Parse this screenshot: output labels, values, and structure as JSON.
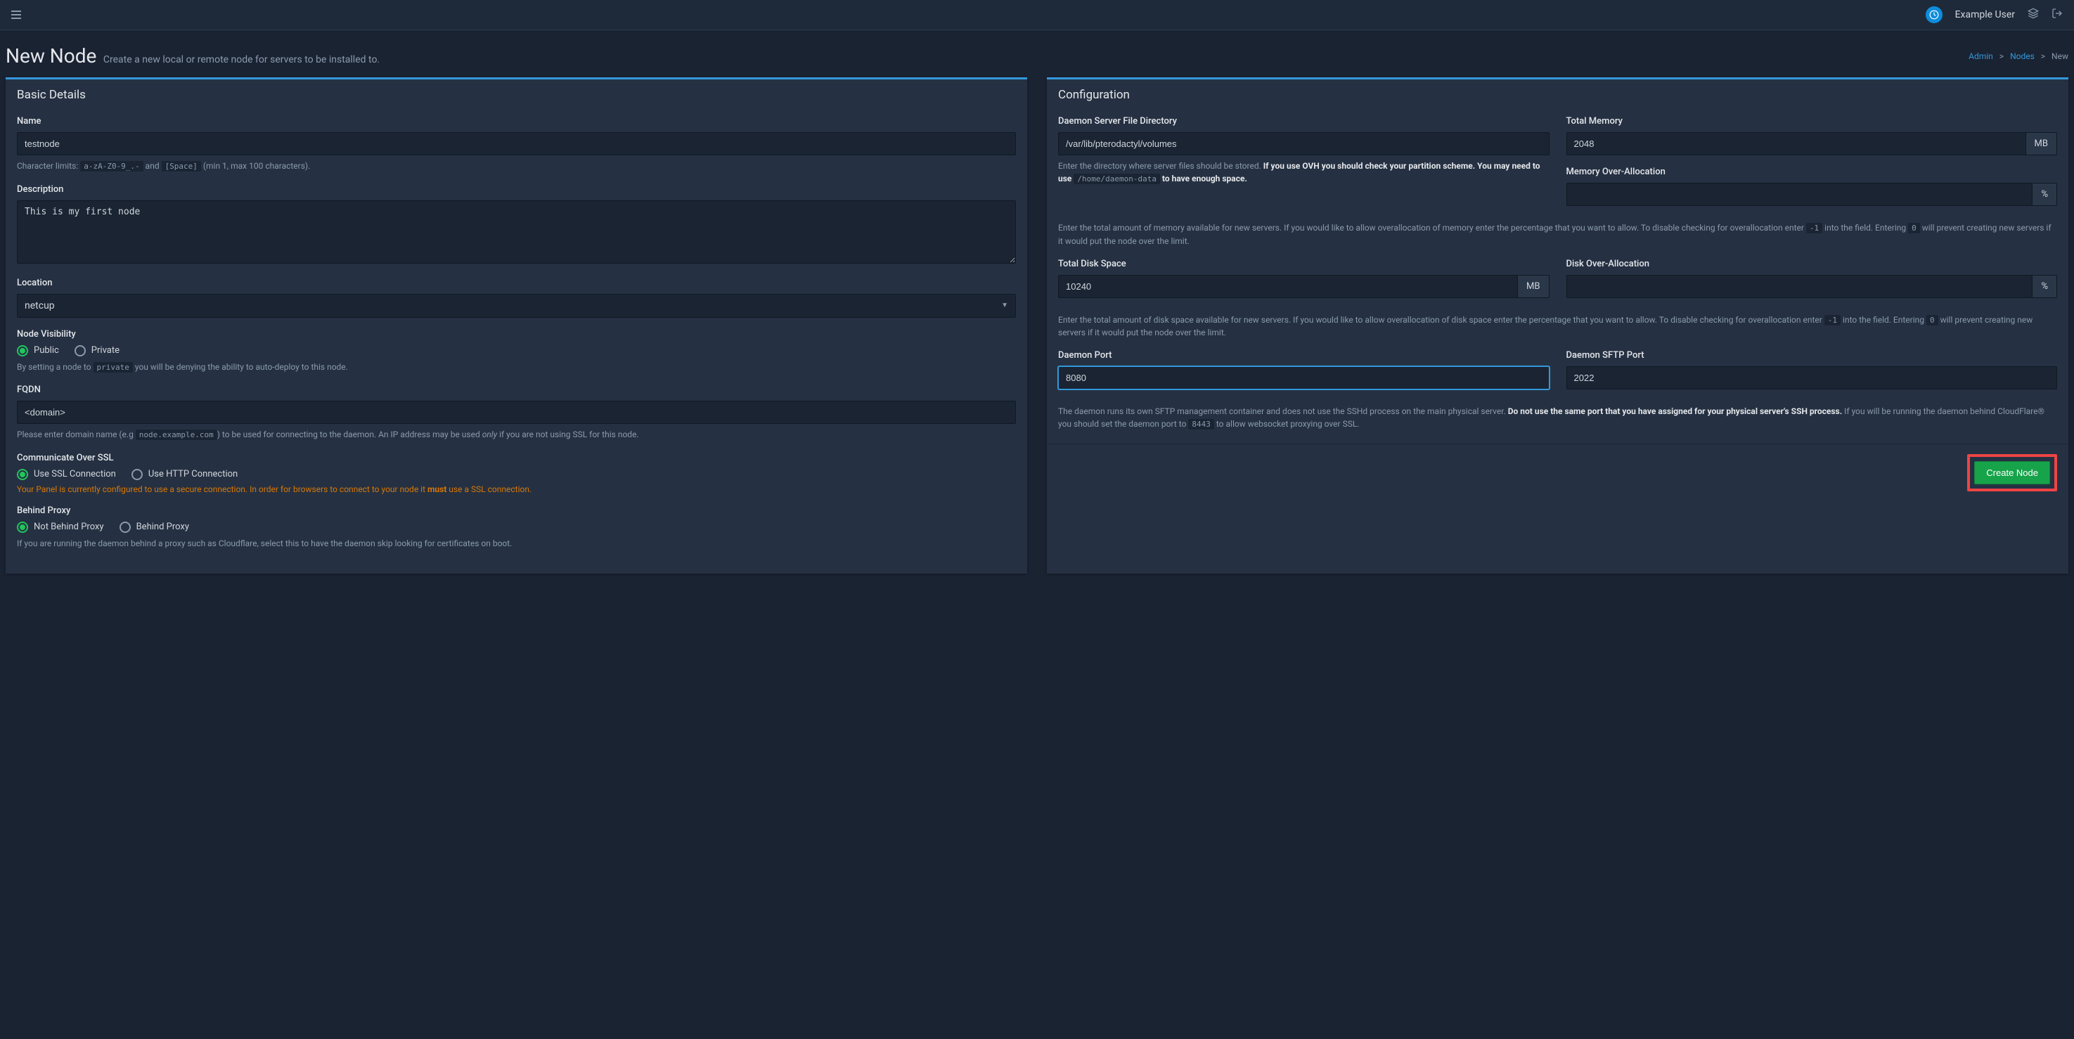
{
  "topbar": {
    "username": "Example User"
  },
  "header": {
    "title": "New Node",
    "subtitle": "Create a new local or remote node for servers to be installed to."
  },
  "breadcrumb": {
    "admin": "Admin",
    "nodes": "Nodes",
    "current": "New"
  },
  "basic": {
    "panel_title": "Basic Details",
    "name_label": "Name",
    "name_value": "testnode",
    "name_help_prefix": "Character limits: ",
    "name_help_code1": "a-zA-Z0-9_.-",
    "name_help_and": " and ",
    "name_help_code2": "[Space]",
    "name_help_suffix": " (min 1, max 100 characters).",
    "description_label": "Description",
    "description_value": "This is my first node",
    "location_label": "Location",
    "location_value": "netcup",
    "visibility_label": "Node Visibility",
    "visibility_public": "Public",
    "visibility_private": "Private",
    "visibility_help_prefix": "By setting a node to ",
    "visibility_help_code": "private",
    "visibility_help_suffix": " you will be denying the ability to auto-deploy to this node.",
    "fqdn_label": "FQDN",
    "fqdn_value": "<domain>",
    "fqdn_help_prefix": "Please enter domain name (e.g ",
    "fqdn_help_code": "node.example.com",
    "fqdn_help_mid": ") to be used for connecting to the daemon. An IP address may be used ",
    "fqdn_help_em": "only",
    "fqdn_help_suffix": " if you are not using SSL for this node.",
    "ssl_label": "Communicate Over SSL",
    "ssl_use": "Use SSL Connection",
    "ssl_http": "Use HTTP Connection",
    "ssl_warning_prefix": "Your Panel is currently configured to use a secure connection. In order for browsers to connect to your node it ",
    "ssl_warning_bold": "must",
    "ssl_warning_suffix": " use a SSL connection.",
    "proxy_label": "Behind Proxy",
    "proxy_not": "Not Behind Proxy",
    "proxy_yes": "Behind Proxy",
    "proxy_help": "If you are running the daemon behind a proxy such as Cloudflare, select this to have the daemon skip looking for certificates on boot."
  },
  "config": {
    "panel_title": "Configuration",
    "dir_label": "Daemon Server File Directory",
    "dir_value": "/var/lib/pterodactyl/volumes",
    "dir_help_prefix": "Enter the directory where server files should be stored. ",
    "dir_help_bold": "If you use OVH you should check your partition scheme. You may need to use ",
    "dir_help_code": "/home/daemon-data",
    "dir_help_bold2": " to have enough space.",
    "memory_label": "Total Memory",
    "memory_value": "2048",
    "memory_unit": "MB",
    "memory_over_label": "Memory Over-Allocation",
    "memory_over_value": "",
    "percent": "%",
    "memory_help_prefix": "Enter the total amount of memory available for new servers. If you would like to allow overallocation of memory enter the percentage that you want to allow. To disable checking for overallocation enter ",
    "memory_help_code1": "-1",
    "memory_help_mid": " into the field. Entering ",
    "memory_help_code2": "0",
    "memory_help_suffix": " will prevent creating new servers if it would put the node over the limit.",
    "disk_label": "Total Disk Space",
    "disk_value": "10240",
    "disk_unit": "MB",
    "disk_over_label": "Disk Over-Allocation",
    "disk_over_value": "",
    "disk_help_prefix": "Enter the total amount of disk space available for new servers. If you would like to allow overallocation of disk space enter the percentage that you want to allow. To disable checking for overallocation enter ",
    "disk_help_code1": "-1",
    "disk_help_mid": " into the field. Entering ",
    "disk_help_code2": "0",
    "disk_help_suffix": " will prevent creating new servers if it would put the node over the limit.",
    "daemon_port_label": "Daemon Port",
    "daemon_port_value": "8080",
    "sftp_port_label": "Daemon SFTP Port",
    "sftp_port_value": "2022",
    "sftp_help_prefix": "The daemon runs its own SFTP management container and does not use the SSHd process on the main physical server. ",
    "sftp_help_bold": "Do not use the same port that you have assigned for your physical server's SSH process.",
    "sftp_help_mid": " If you will be running the daemon behind CloudFlare® you should set the daemon port to ",
    "sftp_help_code": "8443",
    "sftp_help_suffix": " to allow websocket proxying over SSL.",
    "create_button": "Create Node"
  }
}
